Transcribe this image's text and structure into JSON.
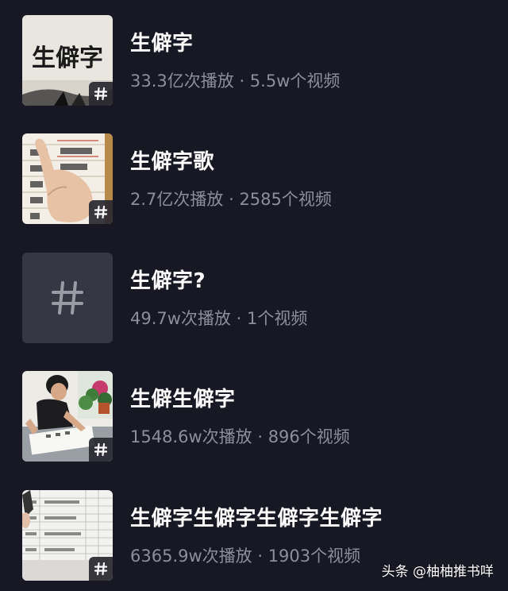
{
  "topics": [
    {
      "title": "生僻字",
      "plays": "33.3亿次播放",
      "videos": "5.5w个视频",
      "thumb": "calligraphy",
      "thumb_text": "生僻字"
    },
    {
      "title": "生僻字歌",
      "plays": "2.7亿次播放",
      "videos": "2585个视频",
      "thumb": "worksheet-hand"
    },
    {
      "title": "生僻字?",
      "plays": "49.7w次播放",
      "videos": "1个视频",
      "thumb": "placeholder-hash"
    },
    {
      "title": "生僻生僻字",
      "plays": "1548.6w次播放",
      "videos": "896个视频",
      "thumb": "person-writing"
    },
    {
      "title": "生僻字生僻字生僻字生僻字",
      "plays": "6365.9w次播放",
      "videos": "1903个视频",
      "thumb": "table-sheet"
    }
  ],
  "separator": " · ",
  "watermark": "头条 @柚柚推书咩",
  "colors": {
    "background": "#171823",
    "title": "#ffffff",
    "meta": "#8c8e99",
    "placeholder_bg": "#363742"
  },
  "icons": {
    "badge": "hashtag-icon"
  }
}
